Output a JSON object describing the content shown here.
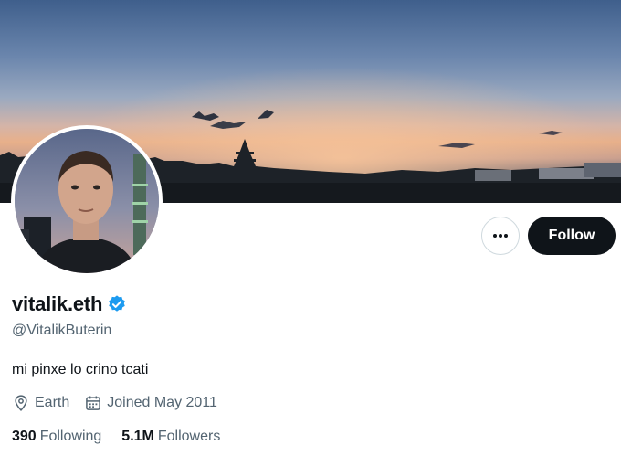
{
  "profile": {
    "display_name": "vitalik.eth",
    "handle": "@VitalikButerin",
    "bio": "mi pinxe lo crino tcati",
    "location": "Earth",
    "joined": "Joined May 2011",
    "following_count": "390",
    "following_label": "Following",
    "followers_count": "5.1M",
    "followers_label": "Followers",
    "verified": true
  },
  "actions": {
    "follow_label": "Follow",
    "more_icon": "more-horizontal-icon"
  },
  "icons": {
    "location": "location-pin-icon",
    "calendar": "calendar-icon",
    "verified": "verified-badge-icon"
  },
  "colors": {
    "primary_text": "#0f1419",
    "secondary_text": "#536471",
    "verified_blue": "#1d9bf0",
    "follow_bg": "#0f1419",
    "border": "#cfd9de"
  }
}
